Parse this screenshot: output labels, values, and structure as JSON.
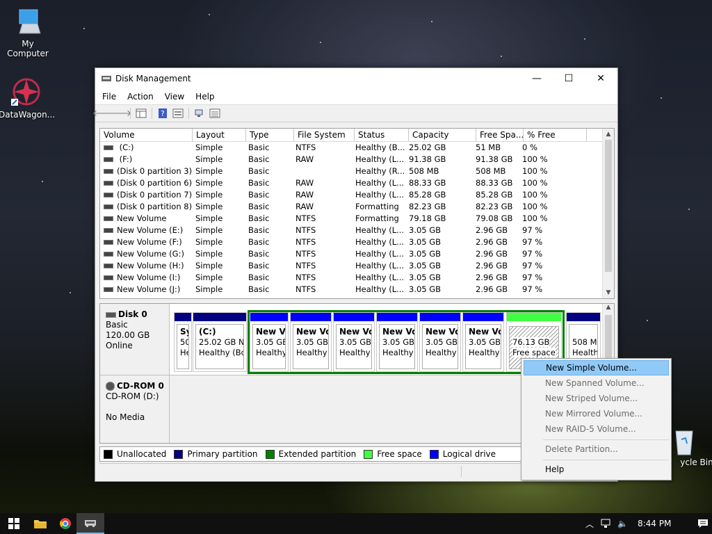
{
  "desktop": {
    "icons": [
      {
        "label": "My Computer"
      },
      {
        "label": "DataWagon..."
      },
      {
        "label": "ycle Bin"
      }
    ]
  },
  "window": {
    "title": "Disk Management",
    "minimize": "—",
    "maximize": "☐",
    "close": "✕"
  },
  "menu": [
    "File",
    "Action",
    "View",
    "Help"
  ],
  "volume_table": {
    "headers": [
      "Volume",
      "Layout",
      "Type",
      "File System",
      "Status",
      "Capacity",
      "Free Spa...",
      "% Free"
    ],
    "rows": [
      [
        " (C:)",
        "Simple",
        "Basic",
        "NTFS",
        "Healthy (B...",
        "25.02 GB",
        "51 MB",
        "0 %"
      ],
      [
        " (F:)",
        "Simple",
        "Basic",
        "RAW",
        "Healthy (L...",
        "91.38 GB",
        "91.38 GB",
        "100 %"
      ],
      [
        "(Disk 0 partition 3)",
        "Simple",
        "Basic",
        "",
        "Healthy (R...",
        "508 MB",
        "508 MB",
        "100 %"
      ],
      [
        "(Disk 0 partition 6)",
        "Simple",
        "Basic",
        "RAW",
        "Healthy (L...",
        "88.33 GB",
        "88.33 GB",
        "100 %"
      ],
      [
        "(Disk 0 partition 7)",
        "Simple",
        "Basic",
        "RAW",
        "Healthy (L...",
        "85.28 GB",
        "85.28 GB",
        "100 %"
      ],
      [
        "(Disk 0 partition 8)",
        "Simple",
        "Basic",
        "RAW",
        "Formatting",
        "82.23 GB",
        "82.23 GB",
        "100 %"
      ],
      [
        "New Volume",
        "Simple",
        "Basic",
        "NTFS",
        "Formatting",
        "79.18 GB",
        "79.08 GB",
        "100 %"
      ],
      [
        "New Volume (E:)",
        "Simple",
        "Basic",
        "NTFS",
        "Healthy (L...",
        "3.05 GB",
        "2.96 GB",
        "97 %"
      ],
      [
        "New Volume (F:)",
        "Simple",
        "Basic",
        "NTFS",
        "Healthy (L...",
        "3.05 GB",
        "2.96 GB",
        "97 %"
      ],
      [
        "New Volume (G:)",
        "Simple",
        "Basic",
        "NTFS",
        "Healthy (L...",
        "3.05 GB",
        "2.96 GB",
        "97 %"
      ],
      [
        "New Volume (H:)",
        "Simple",
        "Basic",
        "NTFS",
        "Healthy (L...",
        "3.05 GB",
        "2.96 GB",
        "97 %"
      ],
      [
        "New Volume (I:)",
        "Simple",
        "Basic",
        "NTFS",
        "Healthy (L...",
        "3.05 GB",
        "2.96 GB",
        "97 %"
      ],
      [
        "New Volume (J:)",
        "Simple",
        "Basic",
        "NTFS",
        "Healthy (L...",
        "3.05 GB",
        "2.96 GB",
        "97 %"
      ]
    ]
  },
  "disk0": {
    "name": "Disk 0",
    "type": "Basic",
    "size": "120.00 GB",
    "state": "Online",
    "partitions": [
      {
        "name": "Sy",
        "size": "50",
        "status": "He",
        "kind": "primary"
      },
      {
        "name": "(C:)",
        "size": "25.02 GB NT",
        "status": "Healthy (Bo",
        "kind": "primary"
      },
      {
        "name": "New Vc",
        "size": "3.05 GB",
        "status": "Healthy",
        "kind": "logical"
      },
      {
        "name": "New Vol",
        "size": "3.05 GB N",
        "status": "Healthy (",
        "kind": "logical"
      },
      {
        "name": "New Vol",
        "size": "3.05 GB N",
        "status": "Healthy (",
        "kind": "logical"
      },
      {
        "name": "New Vol",
        "size": "3.05 GB N",
        "status": "Healthy (",
        "kind": "logical"
      },
      {
        "name": "New Vol",
        "size": "3.05 GB N",
        "status": "Healthy (",
        "kind": "logical"
      },
      {
        "name": "New Vol",
        "size": "3.05 GB N",
        "status": "Healthy (",
        "kind": "logical"
      },
      {
        "name": "",
        "size": "76.13 GB",
        "status": "Free space",
        "kind": "free"
      },
      {
        "name": "",
        "size": "508 MI",
        "status": "Health",
        "kind": "primary"
      }
    ]
  },
  "cdrom0": {
    "name": "CD-ROM 0",
    "drive": "CD-ROM (D:)",
    "state": "No Media"
  },
  "legend": [
    {
      "label": "Unallocated",
      "color": "#000000"
    },
    {
      "label": "Primary partition",
      "color": "#000080"
    },
    {
      "label": "Extended partition",
      "color": "#008000"
    },
    {
      "label": "Free space",
      "color": "#40ff40"
    },
    {
      "label": "Logical drive",
      "color": "#0000ff"
    }
  ],
  "context_menu": {
    "items": [
      {
        "label": "New Simple Volume...",
        "enabled": true,
        "highlighted": true
      },
      {
        "label": "New Spanned Volume...",
        "enabled": false
      },
      {
        "label": "New Striped Volume...",
        "enabled": false
      },
      {
        "label": "New Mirrored Volume...",
        "enabled": false
      },
      {
        "label": "New RAID-5 Volume...",
        "enabled": false
      },
      {
        "label": "Delete Partition...",
        "enabled": false
      },
      {
        "label": "Help",
        "enabled": true
      }
    ]
  },
  "taskbar": {
    "clock": "8:44 PM",
    "icons": [
      "windows-start-icon",
      "file-explorer-icon",
      "chrome-icon",
      "disk-management-icon"
    ]
  },
  "colors": {
    "primary": "#000080",
    "logical": "#0000ff",
    "extended": "#008000",
    "free": "#40ff40",
    "highlight": "#91c9f7"
  }
}
